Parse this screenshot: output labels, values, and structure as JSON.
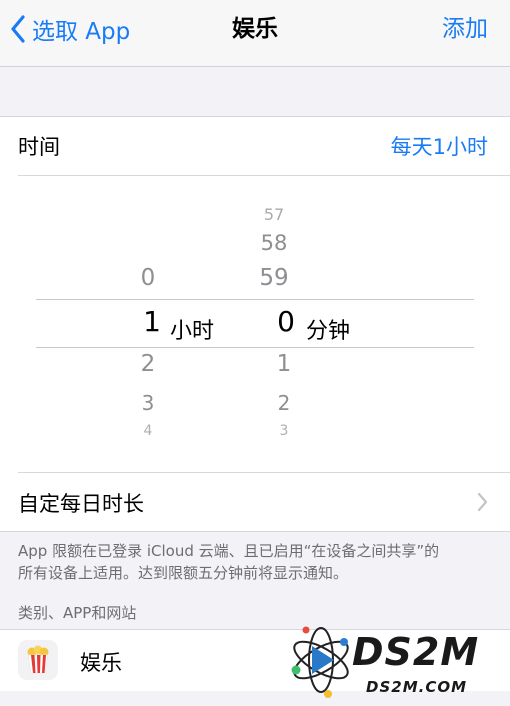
{
  "navbar": {
    "back_label": "选取 App",
    "title": "娱乐",
    "add_label": "添加"
  },
  "time_row": {
    "label": "时间",
    "value": "每天1小时"
  },
  "picker": {
    "hours": {
      "above": [
        "0"
      ],
      "selected": "1",
      "below": [
        "2",
        "3",
        "4"
      ],
      "unit": "小时"
    },
    "minutes": {
      "above": [
        "57",
        "58",
        "59"
      ],
      "selected": "0",
      "below": [
        "1",
        "2",
        "3"
      ],
      "unit": "分钟"
    }
  },
  "custom_row": {
    "label": "自定每日时长"
  },
  "footnote": {
    "line1": "App 限额在已登录 iCloud 云端、且已启用“在设备之间共享”的",
    "line2": "所有设备上适用。达到限额五分钟前将显示通知。"
  },
  "section_header": "类别、APP和网站",
  "category": {
    "label": "娱乐",
    "icon": "popcorn-icon"
  },
  "watermark": {
    "title": "DS2M",
    "subtitle": "DS2M.COM"
  },
  "colors": {
    "accent": "#1a7cf5",
    "background": "#f2f2f7"
  }
}
